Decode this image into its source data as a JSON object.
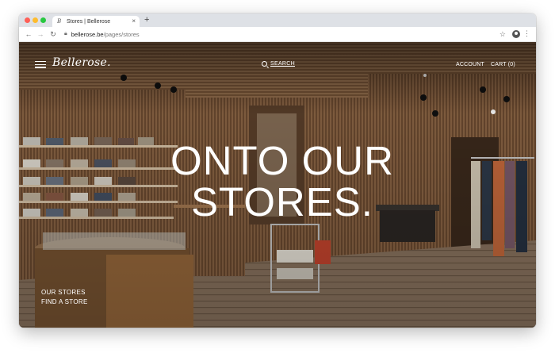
{
  "browser": {
    "tab_title": "Stores | Bellerose",
    "tab_favicon": "B",
    "new_tab": "+",
    "tab_close": "×",
    "url_domain": "bellerose.be",
    "url_path": "/pages/stores"
  },
  "site": {
    "logo": "Bellerose.",
    "search_label": "SEARCH",
    "account_label": "ACCOUNT",
    "cart_label": "CART (0)",
    "hero_line1": "ONTO OUR",
    "hero_line2": "STORES.",
    "link_our_stores": "OUR STORES",
    "link_find_store": "FIND A STORE"
  },
  "icons": [
    "back-arrow-icon",
    "forward-arrow-icon",
    "reload-icon",
    "lock-icon",
    "star-icon",
    "profile-icon",
    "menu-dots-icon",
    "hamburger-icon",
    "search-icon"
  ],
  "colors": {
    "tabbar": "#dee1e6",
    "text_on_photo": "#ffffff"
  }
}
